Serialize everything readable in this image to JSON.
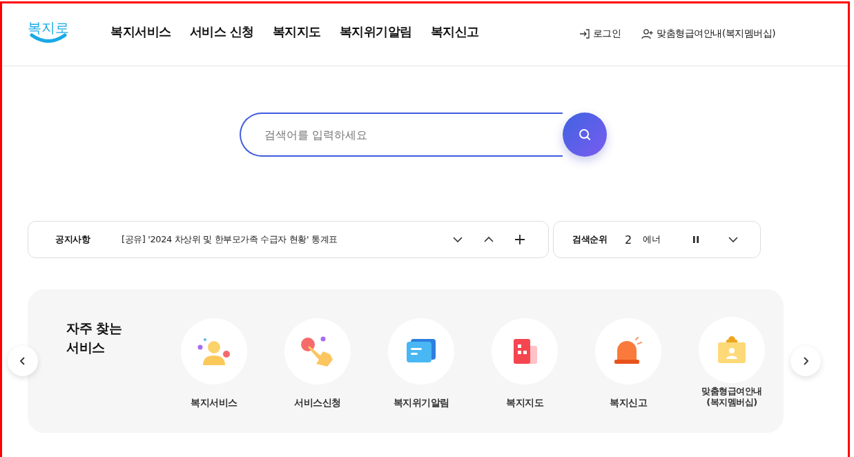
{
  "logo": {
    "text": "복지로"
  },
  "nav": [
    {
      "label": "복지서비스"
    },
    {
      "label": "서비스 신청"
    },
    {
      "label": "복지지도"
    },
    {
      "label": "복지위기알림"
    },
    {
      "label": "복지신고"
    }
  ],
  "header_links": [
    {
      "label": "로그인",
      "kind": "login"
    },
    {
      "label": "맞춤형급여안내(복지멤버십)",
      "kind": "member"
    }
  ],
  "search": {
    "placeholder": "검색어를 입력하세요"
  },
  "notice": {
    "label": "공지사항",
    "text": "[공유] '2024 차상위 및 한부모가족 수급자 현황' 통계표"
  },
  "ranking": {
    "label": "검색순위",
    "rank": "2",
    "term": "에너"
  },
  "frequent": {
    "title": "자주 찾는\n서비스",
    "items": [
      {
        "label": "복지서비스",
        "kind": "person"
      },
      {
        "label": "서비스신청",
        "kind": "hand"
      },
      {
        "label": "복지위기알림",
        "kind": "message"
      },
      {
        "label": "복지지도",
        "kind": "building"
      },
      {
        "label": "복지신고",
        "kind": "siren"
      },
      {
        "label": "맞춤형급여안내\n(복지멤버십)",
        "kind": "badge"
      }
    ]
  }
}
